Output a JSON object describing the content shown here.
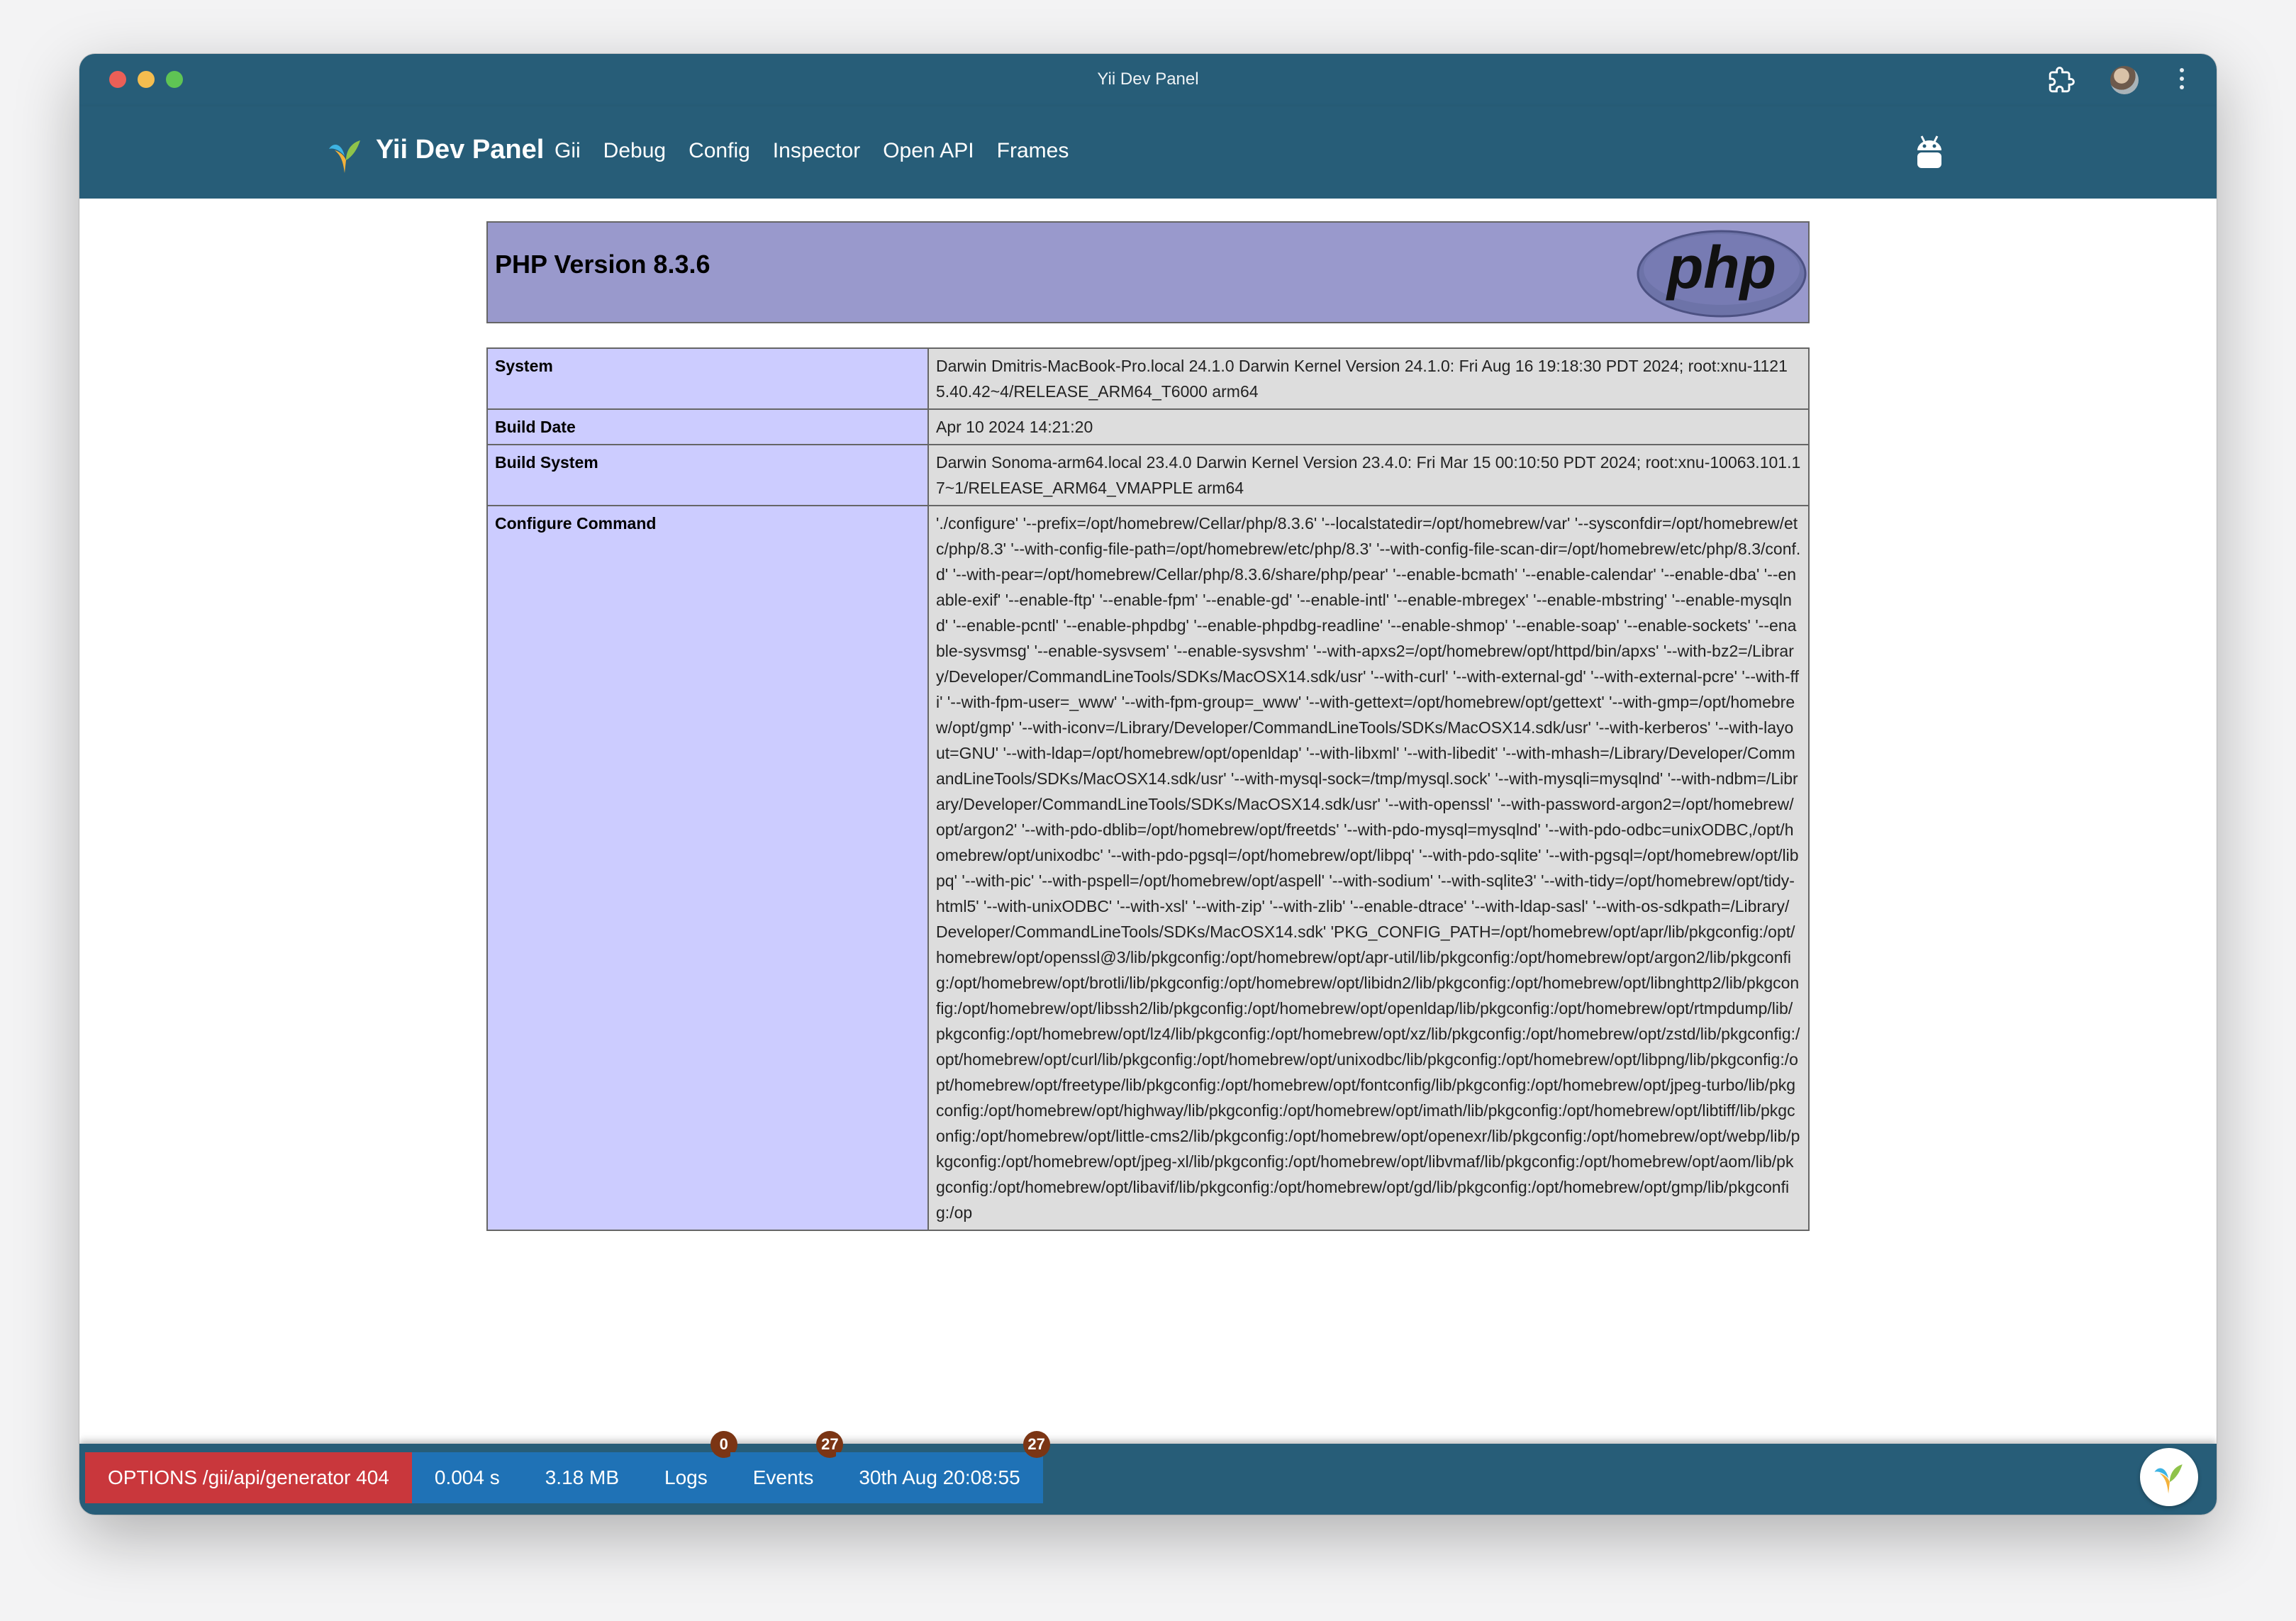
{
  "window": {
    "title": "Yii Dev Panel"
  },
  "navbar": {
    "brand": "Yii Dev Panel",
    "items": [
      {
        "label": "Gii"
      },
      {
        "label": "Debug"
      },
      {
        "label": "Config"
      },
      {
        "label": "Inspector"
      },
      {
        "label": "Open API"
      },
      {
        "label": "Frames"
      }
    ],
    "icons": [
      "yii-logo-icon",
      "android-icon",
      "extensions-icon",
      "avatar",
      "more-vert-icon"
    ]
  },
  "php_info": {
    "title": "PHP Version 8.3.6",
    "logo_text": "php",
    "rows": [
      {
        "key": "System",
        "value": "Darwin Dmitris-MacBook-Pro.local 24.1.0 Darwin Kernel Version 24.1.0: Fri Aug 16 19:18:30 PDT 2024; root:xnu-11215.40.42~4/RELEASE_ARM64_T6000 arm64"
      },
      {
        "key": "Build Date",
        "value": "Apr 10 2024 14:21:20"
      },
      {
        "key": "Build System",
        "value": "Darwin Sonoma-arm64.local 23.4.0 Darwin Kernel Version 23.4.0: Fri Mar 15 00:10:50 PDT 2024; root:xnu-10063.101.17~1/RELEASE_ARM64_VMAPPLE arm64"
      },
      {
        "key": "Configure Command",
        "value": "'./configure' '--prefix=/opt/homebrew/Cellar/php/8.3.6' '--localstatedir=/opt/homebrew/var' '--sysconfdir=/opt/homebrew/etc/php/8.3' '--with-config-file-path=/opt/homebrew/etc/php/8.3' '--with-config-file-scan-dir=/opt/homebrew/etc/php/8.3/conf.d' '--with-pear=/opt/homebrew/Cellar/php/8.3.6/share/php/pear' '--enable-bcmath' '--enable-calendar' '--enable-dba' '--enable-exif' '--enable-ftp' '--enable-fpm' '--enable-gd' '--enable-intl' '--enable-mbregex' '--enable-mbstring' '--enable-mysqlnd' '--enable-pcntl' '--enable-phpdbg' '--enable-phpdbg-readline' '--enable-shmop' '--enable-soap' '--enable-sockets' '--enable-sysvmsg' '--enable-sysvsem' '--enable-sysvshm' '--with-apxs2=/opt/homebrew/opt/httpd/bin/apxs' '--with-bz2=/Library/Developer/CommandLineTools/SDKs/MacOSX14.sdk/usr' '--with-curl' '--with-external-gd' '--with-external-pcre' '--with-ffi' '--with-fpm-user=_www' '--with-fpm-group=_www' '--with-gettext=/opt/homebrew/opt/gettext' '--with-gmp=/opt/homebrew/opt/gmp' '--with-iconv=/Library/Developer/CommandLineTools/SDKs/MacOSX14.sdk/usr' '--with-kerberos' '--with-layout=GNU' '--with-ldap=/opt/homebrew/opt/openldap' '--with-libxml' '--with-libedit' '--with-mhash=/Library/Developer/CommandLineTools/SDKs/MacOSX14.sdk/usr' '--with-mysql-sock=/tmp/mysql.sock' '--with-mysqli=mysqlnd' '--with-ndbm=/Library/Developer/CommandLineTools/SDKs/MacOSX14.sdk/usr' '--with-openssl' '--with-password-argon2=/opt/homebrew/opt/argon2' '--with-pdo-dblib=/opt/homebrew/opt/freetds' '--with-pdo-mysql=mysqlnd' '--with-pdo-odbc=unixODBC,/opt/homebrew/opt/unixodbc' '--with-pdo-pgsql=/opt/homebrew/opt/libpq' '--with-pdo-sqlite' '--with-pgsql=/opt/homebrew/opt/libpq' '--with-pic' '--with-pspell=/opt/homebrew/opt/aspell' '--with-sodium' '--with-sqlite3' '--with-tidy=/opt/homebrew/opt/tidy-html5' '--with-unixODBC' '--with-xsl' '--with-zip' '--with-zlib' '--enable-dtrace' '--with-ldap-sasl' '--with-os-sdkpath=/Library/Developer/CommandLineTools/SDKs/MacOSX14.sdk' 'PKG_CONFIG_PATH=/opt/homebrew/opt/apr/lib/pkgconfig:/opt/homebrew/opt/openssl@3/lib/pkgconfig:/opt/homebrew/opt/apr-util/lib/pkgconfig:/opt/homebrew/opt/argon2/lib/pkgconfig:/opt/homebrew/opt/brotli/lib/pkgconfig:/opt/homebrew/opt/libidn2/lib/pkgconfig:/opt/homebrew/opt/libnghttp2/lib/pkgconfig:/opt/homebrew/opt/libssh2/lib/pkgconfig:/opt/homebrew/opt/openldap/lib/pkgconfig:/opt/homebrew/opt/rtmpdump/lib/pkgconfig:/opt/homebrew/opt/lz4/lib/pkgconfig:/opt/homebrew/opt/xz/lib/pkgconfig:/opt/homebrew/opt/zstd/lib/pkgconfig:/opt/homebrew/opt/curl/lib/pkgconfig:/opt/homebrew/opt/unixodbc/lib/pkgconfig:/opt/homebrew/opt/libpng/lib/pkgconfig:/opt/homebrew/opt/freetype/lib/pkgconfig:/opt/homebrew/opt/fontconfig/lib/pkgconfig:/opt/homebrew/opt/jpeg-turbo/lib/pkgconfig:/opt/homebrew/opt/highway/lib/pkgconfig:/opt/homebrew/opt/imath/lib/pkgconfig:/opt/homebrew/opt/libtiff/lib/pkgconfig:/opt/homebrew/opt/little-cms2/lib/pkgconfig:/opt/homebrew/opt/openexr/lib/pkgconfig:/opt/homebrew/opt/webp/lib/pkgconfig:/opt/homebrew/opt/jpeg-xl/lib/pkgconfig:/opt/homebrew/opt/libvmaf/lib/pkgconfig:/opt/homebrew/opt/aom/lib/pkgconfig:/opt/homebrew/opt/libavif/lib/pkgconfig:/opt/homebrew/opt/gd/lib/pkgconfig:/opt/homebrew/opt/gmp/lib/pkgconfig:/op"
      }
    ]
  },
  "debugbar": {
    "request": "OPTIONS /gii/api/generator 404",
    "time": "0.004 s",
    "memory": "3.18 MB",
    "logs": {
      "label": "Logs",
      "count": "0"
    },
    "events": {
      "label": "Events",
      "count": "27"
    },
    "timestamp": {
      "label": "30th Aug 20:08:55",
      "count": "27"
    }
  },
  "colors": {
    "primary": "#275d78",
    "php_header": "#9999cc",
    "php_key_cell": "#ccccff",
    "php_value_cell": "#dddddd",
    "debug_item": "#1f72b6",
    "debug_error": "#c9373c",
    "badge": "#7b3514"
  }
}
